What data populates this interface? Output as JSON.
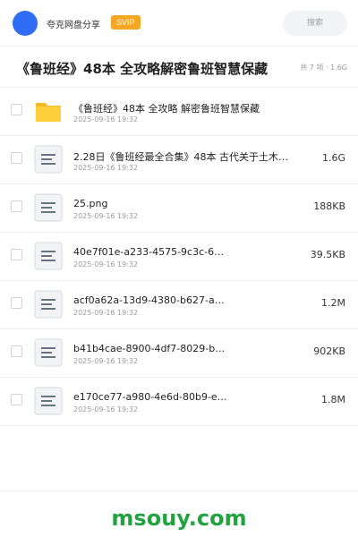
{
  "header": {
    "brand": "夸克网盘分享",
    "badge": "SVIP",
    "search_label": "搜索"
  },
  "share": {
    "title": "《鲁班经》48本 全攻略解密鲁班智慧保藏",
    "meta": "共 7 项 · 1.6G"
  },
  "files": [
    {
      "name": "《鲁班经》48本 全攻略 解密鲁班智慧保藏",
      "date": "2025-09-16 19:32",
      "size": "",
      "icon": "folder-icon"
    },
    {
      "name": "2.28日《鲁班经最全合集》48本 古代关于土木建…",
      "date": "2025-09-16 19:32",
      "size": "1.6G",
      "icon": "file-doc-icon"
    },
    {
      "name": "25.png",
      "date": "2025-09-16 19:32",
      "size": "188KB",
      "icon": "file-doc-icon"
    },
    {
      "name": "40e7f01e-a233-4575-9c3c-6…",
      "date": "2025-09-16 19:32",
      "size": "39.5KB",
      "icon": "file-doc-icon"
    },
    {
      "name": "acf0a62a-13d9-4380-b627-a…",
      "date": "2025-09-16 19:32",
      "size": "1.2M",
      "icon": "file-doc-icon"
    },
    {
      "name": "b41b4cae-8900-4df7-8029-b…",
      "date": "2025-09-16 19:32",
      "size": "902KB",
      "icon": "file-doc-icon"
    },
    {
      "name": "e170ce77-a980-4e6d-80b9-e…",
      "date": "2025-09-16 19:32",
      "size": "1.8M",
      "icon": "file-doc-icon"
    }
  ],
  "footer": {
    "watermark": "msouy.com"
  },
  "colors": {
    "accent": "#2f6df6",
    "badge": "#f5a623",
    "folder": "#fbc02d",
    "watermark": "#21a340"
  }
}
